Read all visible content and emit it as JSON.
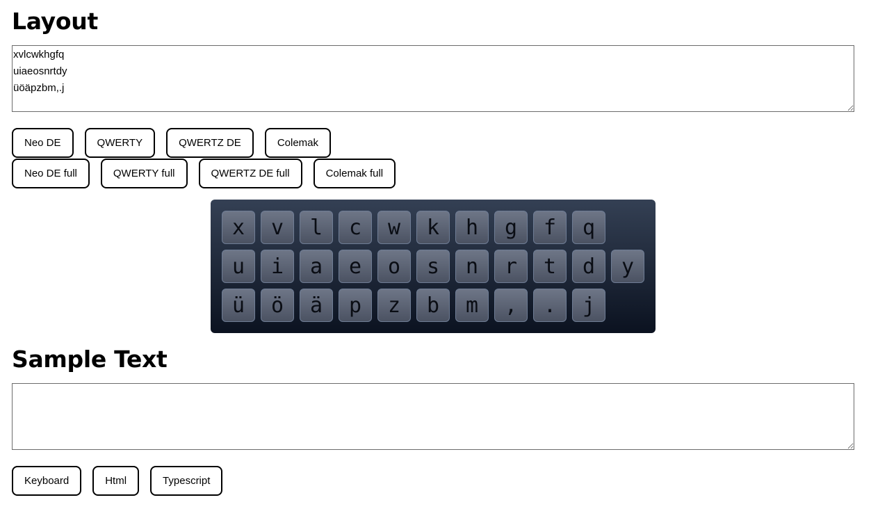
{
  "layout_section": {
    "heading": "Layout",
    "textarea_value": "xvlcwkhgfq\nuiaeosnrtdy\nüöäpzbm,.j"
  },
  "layout_presets": {
    "row1": [
      "Neo DE",
      "QWERTY",
      "QWERTZ DE",
      "Colemak"
    ],
    "row2": [
      "Neo DE full",
      "QWERTY full",
      "QWERTZ DE full",
      "Colemak full"
    ]
  },
  "keyboard": {
    "rows": [
      [
        "x",
        "v",
        "l",
        "c",
        "w",
        "k",
        "h",
        "g",
        "f",
        "q"
      ],
      [
        "u",
        "i",
        "a",
        "e",
        "o",
        "s",
        "n",
        "r",
        "t",
        "d",
        "y"
      ],
      [
        "ü",
        "ö",
        "ä",
        "p",
        "z",
        "b",
        "m",
        ",",
        ".",
        "j"
      ]
    ]
  },
  "sample_section": {
    "heading": "Sample Text",
    "textarea_value": ""
  },
  "sample_presets": [
    "Keyboard",
    "Html",
    "Typescript"
  ]
}
